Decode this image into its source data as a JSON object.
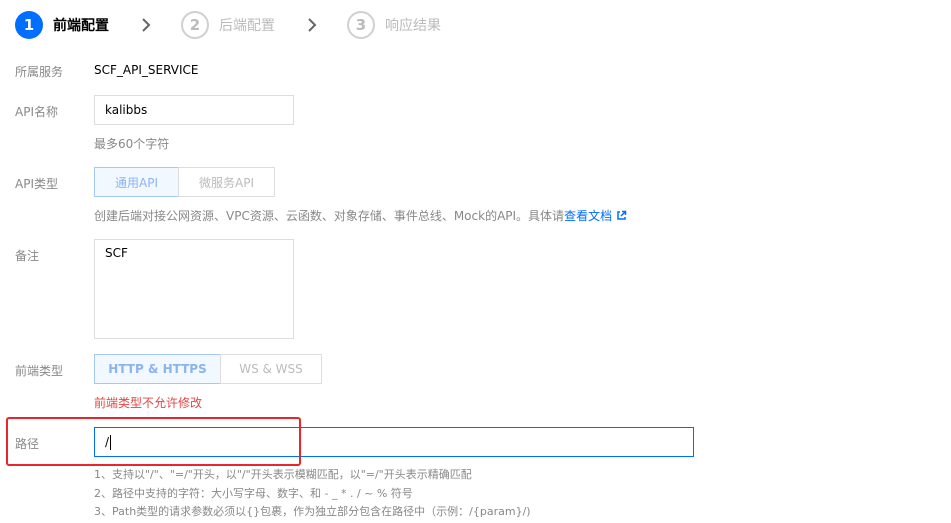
{
  "steps": [
    {
      "num": "1",
      "label": "前端配置"
    },
    {
      "num": "2",
      "label": "后端配置"
    },
    {
      "num": "3",
      "label": "响应结果"
    }
  ],
  "form": {
    "service_label": "所属服务",
    "service_value": "SCF_API_SERVICE",
    "api_name_label": "API名称",
    "api_name_value": "kalibbs",
    "api_name_hint": "最多60个字符",
    "api_type_label": "API类型",
    "api_type_options": [
      "通用API",
      "微服务API"
    ],
    "api_type_hint": "创建后端对接公网资源、VPC资源、云函数、对象存储、事件总线、Mock的API。具体请",
    "api_type_link": "查看文档",
    "remark_label": "备注",
    "remark_value": "SCF",
    "frontend_type_label": "前端类型",
    "frontend_type_options": [
      "HTTP & HTTPS",
      "WS & WSS"
    ],
    "frontend_type_warning": "前端类型不允许修改",
    "path_label": "路径",
    "path_value": "/",
    "path_rules": [
      "1、支持以\"/\"、\"=/\"开头，以\"/\"开头表示模糊匹配，以\"=/\"开头表示精确匹配",
      "2、路径中支持的字符：大小写字母、数字、和 - _ * . / ~ % 符号",
      "3、Path类型的请求参数必须以{}包裹，作为独立部分包含在路径中（示例：/{param}/)"
    ]
  },
  "colors": {
    "primary": "#006eff",
    "warning": "#e54545",
    "highlight": "#e8262c"
  }
}
